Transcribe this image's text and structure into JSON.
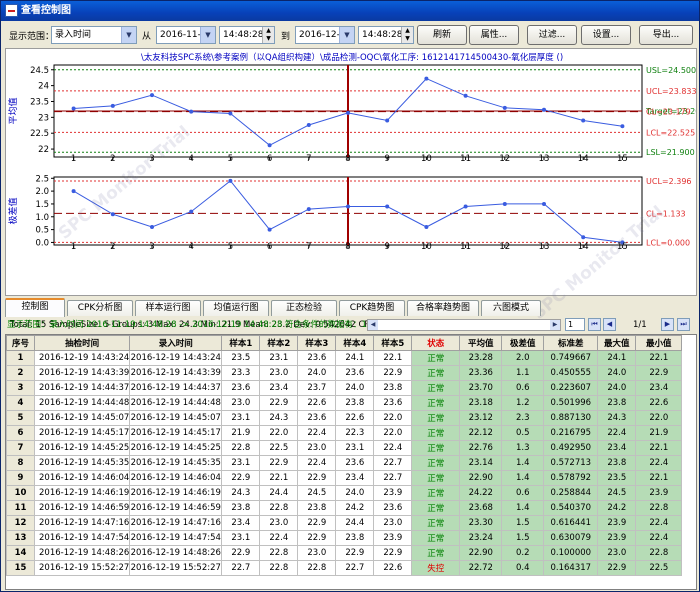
{
  "window": {
    "title": "查看控制图"
  },
  "toolbar": {
    "range_label": "显示范围：",
    "range_value": "录入时间",
    "from_label": "从",
    "from_date": "2016-11-19",
    "from_time": "14:48:28",
    "to_label": "到",
    "to_date": "2016-12-19",
    "to_time": "14:48:28",
    "refresh": "刷新",
    "properties": "属性...",
    "filter": "过滤...",
    "settings": "设置...",
    "export": "导出..."
  },
  "chart_header": "\\太友科技SPC系统\\参考案例（以QA组织构建）\\成品检测-OQC\\氧化工序: 1612141714500430-氧化层厚度        ()",
  "watermark": "SPC Monitor Trial",
  "colors": {
    "series": "#3a5ce0",
    "limit": "#e03030",
    "center": "#900000",
    "spec": "#108010",
    "marker": "#a00000"
  },
  "chart_data": [
    {
      "type": "line",
      "ylabel": "平均值",
      "x": [
        1,
        2,
        3,
        4,
        5,
        6,
        7,
        8,
        9,
        10,
        11,
        12,
        13,
        14,
        15
      ],
      "values": [
        23.28,
        23.36,
        23.7,
        23.18,
        23.12,
        22.12,
        22.76,
        23.14,
        22.9,
        24.22,
        23.68,
        23.3,
        23.24,
        22.9,
        22.72
      ],
      "ylim": [
        21.75,
        24.65
      ],
      "yticks": [
        "24.5",
        "24",
        "23.5",
        "23",
        "22.5",
        "22"
      ],
      "yticks_values": [
        24.5,
        24,
        23.5,
        23,
        22.5,
        22
      ],
      "lines": [
        {
          "label": "USL=24.500",
          "value": 24.5,
          "kind": "spec"
        },
        {
          "label": "UCL=23.833",
          "value": 23.833,
          "kind": "limit"
        },
        {
          "label": "Target=23.200",
          "value": 23.2,
          "kind": "target"
        },
        {
          "label": "CL=23.179",
          "value": 23.179,
          "kind": "center"
        },
        {
          "label": "LCL=22.525",
          "value": 22.525,
          "kind": "limit"
        },
        {
          "label": "LSL=21.900",
          "value": 21.9,
          "kind": "spec"
        }
      ]
    },
    {
      "type": "line",
      "ylabel": "极差值",
      "x": [
        1,
        2,
        3,
        4,
        5,
        6,
        7,
        8,
        9,
        10,
        11,
        12,
        13,
        14,
        15
      ],
      "values": [
        2.0,
        1.1,
        0.6,
        1.2,
        2.4,
        0.5,
        1.3,
        1.4,
        1.4,
        0.6,
        1.4,
        1.5,
        1.5,
        0.2,
        0.0
      ],
      "ylim": [
        -0.1,
        2.55
      ],
      "yticks": [
        "2.5",
        "2.0",
        "1.5",
        "1.0",
        "0.5",
        "0.0"
      ],
      "yticks_values": [
        2.5,
        2.0,
        1.5,
        1.0,
        0.5,
        0.0
      ],
      "lines": [
        {
          "label": "UCL=2.396",
          "value": 2.396,
          "kind": "limit"
        },
        {
          "label": "CL=1.133",
          "value": 1.133,
          "kind": "center"
        },
        {
          "label": "LCL=0.000",
          "value": 0.0,
          "kind": "limit"
        }
      ]
    }
  ],
  "selected_x": 8,
  "stats": "Total: 15   SampleSize: 5   Groups: 3   Max: 24.3   Min: 21.9   Mean: 23.2   Dev: 0.542042   CPK: 0.87   PPK: 0.78   Ca: -0.03   Cp: 0.89   Pp: 0.8",
  "tabs": [
    "控制图",
    "CPK分析图",
    "样本运行图",
    "均值运行图",
    "正态检验",
    "CPK趋势图",
    "合格率趋势图",
    "六图模式"
  ],
  "filter_bar": {
    "text": "显示范围：录入时间  2016-11-19 14:48:28 -> 2016-12-19 14:48:28  符合条件的数据有：15 条",
    "page_value": "1",
    "page_count": "1/1"
  },
  "table": {
    "headers": [
      "序号",
      "抽检时间",
      "录入时间",
      "样本1",
      "样本2",
      "样本3",
      "样本4",
      "样本5",
      "状态",
      "平均值",
      "极差值",
      "标准差",
      "最大值",
      "最小值"
    ],
    "rows": [
      [
        "1",
        "2016-12-19 14:43:24",
        "2016-12-19 14:43:24",
        "23.5",
        "23.1",
        "23.6",
        "24.1",
        "22.1",
        "正常",
        "23.28",
        "2.0",
        "0.749667",
        "24.1",
        "22.1"
      ],
      [
        "2",
        "2016-12-19 14:43:39",
        "2016-12-19 14:43:39",
        "23.3",
        "23.0",
        "24.0",
        "23.6",
        "22.9",
        "正常",
        "23.36",
        "1.1",
        "0.450555",
        "24.0",
        "22.9"
      ],
      [
        "3",
        "2016-12-19 14:44:37",
        "2016-12-19 14:44:37",
        "23.6",
        "23.4",
        "23.7",
        "24.0",
        "23.8",
        "正常",
        "23.70",
        "0.6",
        "0.223607",
        "24.0",
        "23.4"
      ],
      [
        "4",
        "2016-12-19 14:44:48",
        "2016-12-19 14:44:48",
        "23.0",
        "22.9",
        "22.6",
        "23.8",
        "23.6",
        "正常",
        "23.18",
        "1.2",
        "0.501996",
        "23.8",
        "22.6"
      ],
      [
        "5",
        "2016-12-19 14:45:07",
        "2016-12-19 14:45:07",
        "23.1",
        "24.3",
        "23.6",
        "22.6",
        "22.0",
        "正常",
        "23.12",
        "2.3",
        "0.887130",
        "24.3",
        "22.0"
      ],
      [
        "6",
        "2016-12-19 14:45:17",
        "2016-12-19 14:45:17",
        "21.9",
        "22.0",
        "22.4",
        "22.3",
        "22.0",
        "正常",
        "22.12",
        "0.5",
        "0.216795",
        "22.4",
        "21.9"
      ],
      [
        "7",
        "2016-12-19 14:45:25",
        "2016-12-19 14:45:25",
        "22.8",
        "22.5",
        "23.0",
        "23.1",
        "22.4",
        "正常",
        "22.76",
        "1.3",
        "0.492950",
        "23.4",
        "22.1"
      ],
      [
        "8",
        "2016-12-19 14:45:35",
        "2016-12-19 14:45:35",
        "23.1",
        "22.9",
        "22.4",
        "23.6",
        "22.7",
        "正常",
        "23.14",
        "1.4",
        "0.572713",
        "23.8",
        "22.4"
      ],
      [
        "9",
        "2016-12-19 14:46:04",
        "2016-12-19 14:46:04",
        "22.9",
        "22.1",
        "22.9",
        "23.4",
        "22.7",
        "正常",
        "22.90",
        "1.4",
        "0.578792",
        "23.5",
        "22.1"
      ],
      [
        "10",
        "2016-12-19 14:46:19",
        "2016-12-19 14:46:19",
        "24.3",
        "24.4",
        "24.5",
        "24.0",
        "23.9",
        "正常",
        "24.22",
        "0.6",
        "0.258844",
        "24.5",
        "23.9"
      ],
      [
        "11",
        "2016-12-19 14:46:59",
        "2016-12-19 14:46:59",
        "23.8",
        "22.8",
        "23.8",
        "24.2",
        "23.6",
        "正常",
        "23.68",
        "1.4",
        "0.540370",
        "24.2",
        "22.8"
      ],
      [
        "12",
        "2016-12-19 14:47:16",
        "2016-12-19 14:47:16",
        "23.4",
        "23.0",
        "22.9",
        "24.4",
        "23.0",
        "正常",
        "23.30",
        "1.5",
        "0.616441",
        "23.9",
        "22.4"
      ],
      [
        "13",
        "2016-12-19 14:47:54",
        "2016-12-19 14:47:54",
        "23.1",
        "22.4",
        "22.9",
        "23.8",
        "23.9",
        "正常",
        "23.24",
        "1.5",
        "0.630079",
        "23.9",
        "22.4"
      ],
      [
        "14",
        "2016-12-19 14:48:26",
        "2016-12-19 14:48:26",
        "22.9",
        "22.8",
        "23.0",
        "22.9",
        "22.9",
        "正常",
        "22.90",
        "0.2",
        "0.100000",
        "23.0",
        "22.8"
      ],
      [
        "15",
        "2016-12-19 15:52:27",
        "2016-12-19 15:52:27",
        "22.7",
        "22.8",
        "22.8",
        "22.7",
        "22.6",
        "失控",
        "22.72",
        "0.4",
        "0.164317",
        "22.9",
        "22.5"
      ]
    ]
  }
}
